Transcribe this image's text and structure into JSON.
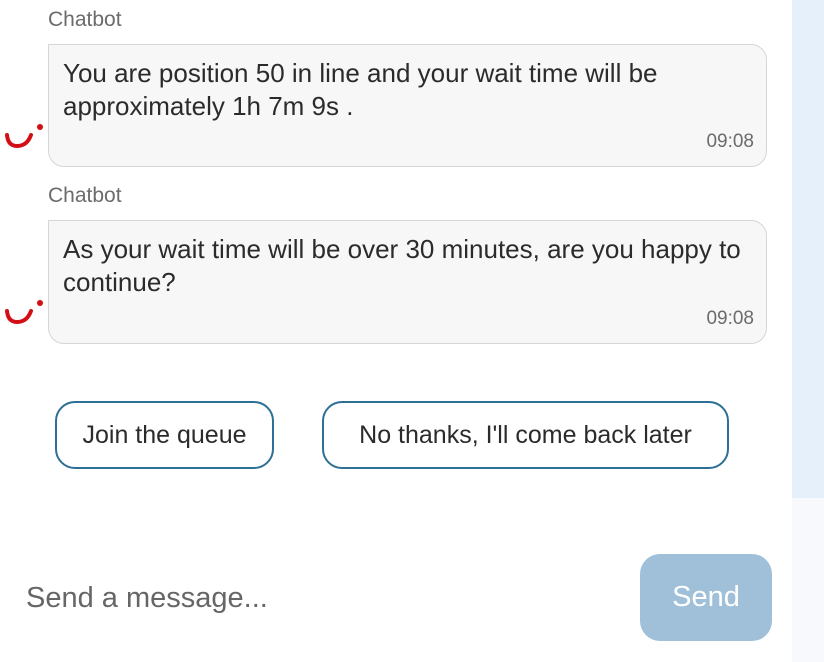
{
  "messages": [
    {
      "sender": "Chatbot",
      "text": "You are position 50 in line and your wait time will be approximately 1h 7m 9s .",
      "time": "09:08"
    },
    {
      "sender": "Chatbot",
      "text": "As your wait time will be over 30 minutes, are you happy to continue?",
      "time": "09:08"
    }
  ],
  "quick_replies": [
    {
      "label": "Join the queue"
    },
    {
      "label": "No thanks, I'll come back later"
    }
  ],
  "composer": {
    "placeholder": "Send a message...",
    "send_label": "Send"
  },
  "colors": {
    "brand": "#d40e14",
    "button_border": "#2d6f95",
    "send_button": "#a0c0d9",
    "side_panel": "#e6f0fb"
  },
  "icons": {
    "avatar": "tui-smile-logo-icon"
  }
}
